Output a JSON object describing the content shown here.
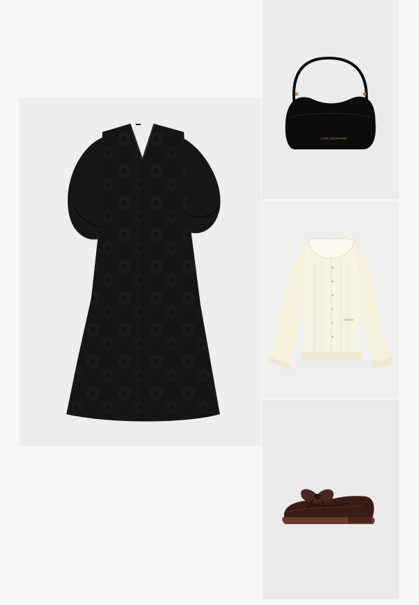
{
  "outfit": {
    "items": [
      {
        "id": "dress",
        "icon": "black-jacquard-midi-dress"
      },
      {
        "id": "bag",
        "icon": "black-shoulder-bag",
        "brand_text": "LOVE MOSCHINO"
      },
      {
        "id": "top",
        "icon": "cream-ruffle-cardigan"
      },
      {
        "id": "loafer",
        "icon": "burgundy-bow-loafer"
      }
    ]
  },
  "colors": {
    "dress": "#151515",
    "bag": "#0d0d0d",
    "top": "#f4efdf",
    "loafer": "#3a1c16"
  }
}
